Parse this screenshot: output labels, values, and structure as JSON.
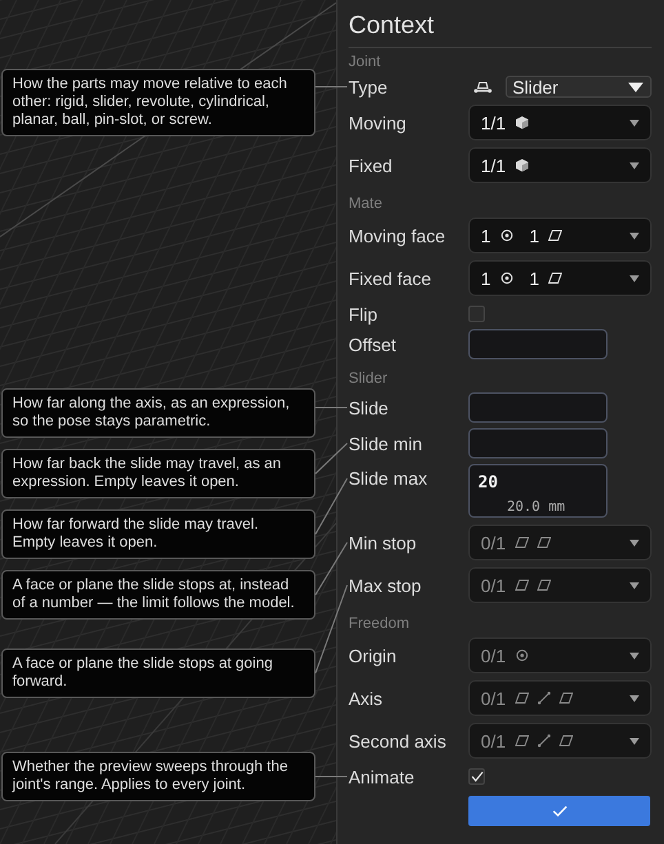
{
  "panel": {
    "title": "Context",
    "sections": [
      {
        "heading": "Joint",
        "rows": [
          {
            "kind": "select",
            "label": "Type",
            "value": "Slider",
            "tooltip": "How the parts may move relative to each other: rigid, slider, revolute, cylindrical, planar, ball, pin-slot, or screw."
          },
          {
            "kind": "picker",
            "label": "Moving",
            "muted": false,
            "segments": [
              {
                "count": "1/1",
                "icons": [
                  {
                    "kind": "solid"
                  }
                ]
              }
            ]
          },
          {
            "kind": "picker",
            "label": "Fixed",
            "muted": false,
            "segments": [
              {
                "count": "1/1",
                "icons": [
                  {
                    "kind": "solid"
                  }
                ]
              }
            ]
          }
        ]
      },
      {
        "heading": "Mate",
        "rows": [
          {
            "kind": "picker",
            "label": "Moving face",
            "muted": false,
            "segments": [
              {
                "count": "1",
                "icons": [
                  {
                    "kind": "point"
                  }
                ]
              },
              {
                "count": "1",
                "icons": [
                  {
                    "kind": "face"
                  }
                ]
              }
            ]
          },
          {
            "kind": "picker",
            "label": "Fixed face",
            "muted": false,
            "segments": [
              {
                "count": "1",
                "icons": [
                  {
                    "kind": "point"
                  }
                ]
              },
              {
                "count": "1",
                "icons": [
                  {
                    "kind": "face"
                  }
                ]
              }
            ]
          },
          {
            "kind": "checkbox",
            "label": "Flip",
            "checked": false
          },
          {
            "kind": "input",
            "label": "Offset"
          }
        ]
      },
      {
        "heading": "Slider",
        "rows": [
          {
            "kind": "input",
            "label": "Slide",
            "tooltip": "How far along the axis, as an expression, so the pose stays parametric."
          },
          {
            "kind": "input",
            "label": "Slide min",
            "tooltip": "How far back the slide may travel, as an expression. Empty leaves it open."
          },
          {
            "kind": "expression",
            "label": "Slide max",
            "value": "20",
            "preview": "20.0 mm",
            "tooltip": "How far forward the slide may travel. Empty leaves it open."
          },
          {
            "kind": "picker",
            "label": "Min stop",
            "muted": true,
            "segments": [
              {
                "count": "0/1",
                "icons": [
                  {
                    "kind": "face"
                  },
                  {
                    "kind": "face"
                  }
                ]
              }
            ],
            "tooltip": "A face or plane the slide stops at, instead of a number — the limit follows the model."
          },
          {
            "kind": "picker",
            "label": "Max stop",
            "muted": true,
            "segments": [
              {
                "count": "0/1",
                "icons": [
                  {
                    "kind": "face"
                  },
                  {
                    "kind": "face"
                  }
                ]
              }
            ],
            "tooltip": "A face or plane the slide stops at going forward."
          }
        ]
      },
      {
        "heading": "Freedom",
        "rows": [
          {
            "kind": "picker",
            "label": "Origin",
            "muted": true,
            "segments": [
              {
                "count": "0/1",
                "icons": [
                  {
                    "kind": "point"
                  }
                ]
              }
            ]
          },
          {
            "kind": "picker",
            "label": "Axis",
            "muted": true,
            "segments": [
              {
                "count": "0/1",
                "icons": [
                  {
                    "kind": "face"
                  },
                  {
                    "kind": "edge"
                  },
                  {
                    "kind": "face"
                  }
                ]
              }
            ]
          },
          {
            "kind": "picker",
            "label": "Second axis",
            "muted": true,
            "segments": [
              {
                "count": "0/1",
                "icons": [
                  {
                    "kind": "face"
                  },
                  {
                    "kind": "edge"
                  },
                  {
                    "kind": "face"
                  }
                ]
              }
            ]
          },
          {
            "kind": "checkbox",
            "label": "Animate",
            "checked": true,
            "tooltip": "Whether the preview sweeps through the joint's range. Applies to every joint."
          }
        ]
      }
    ]
  }
}
